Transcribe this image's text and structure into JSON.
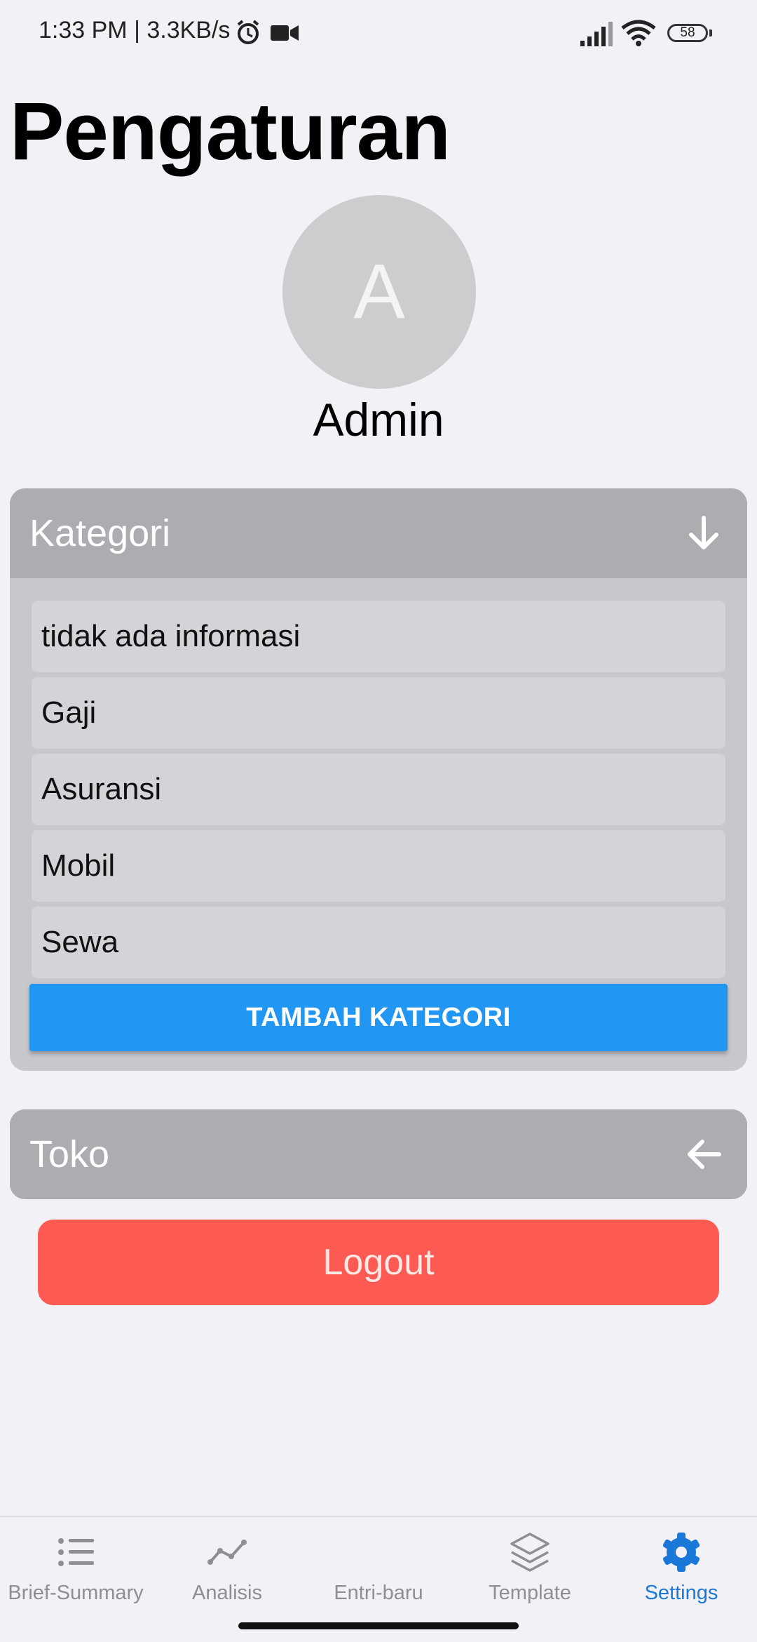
{
  "status_bar": {
    "time_speed": "1:33 PM | 3.3KB/s",
    "battery": "58"
  },
  "page": {
    "title": "Pengaturan"
  },
  "profile": {
    "initial": "A",
    "name": "Admin"
  },
  "kategori": {
    "header": "Kategori",
    "items": [
      "tidak ada informasi",
      "Gaji",
      "Asuransi",
      "Mobil",
      "Sewa"
    ],
    "add_button": "TAMBAH KATEGORI"
  },
  "toko": {
    "header": "Toko"
  },
  "logout": {
    "label": "Logout"
  },
  "colors": {
    "accent": "#2196f3",
    "danger": "#fd5a53",
    "active_tab": "#1a78d8"
  },
  "bottom_nav": [
    {
      "label": "Brief-Summary",
      "icon": "list-icon"
    },
    {
      "label": "Analisis",
      "icon": "chart-line-icon"
    },
    {
      "label": "Entri-baru",
      "icon": "none"
    },
    {
      "label": "Template",
      "icon": "layers-icon"
    },
    {
      "label": "Settings",
      "icon": "gear-icon",
      "active": true
    }
  ]
}
